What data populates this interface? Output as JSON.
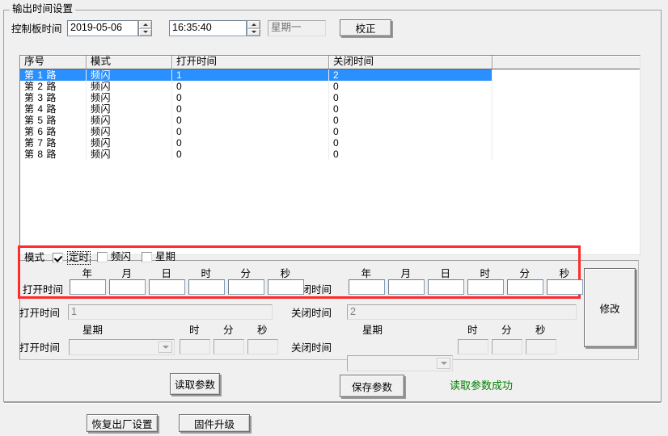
{
  "group": {
    "title": "输出时间设置"
  },
  "topbar": {
    "label": "控制板时间",
    "date_value": "2019-05-06",
    "time_value": "16:35:40",
    "weekday_value": "星期一",
    "correct_button": "校正"
  },
  "listview": {
    "columns": [
      "序号",
      "模式",
      "打开时间",
      "关闭时间",
      ""
    ],
    "rows": [
      {
        "no": "第 1 路",
        "mode": "频闪",
        "on": "1",
        "off": "2",
        "selected": true
      },
      {
        "no": "第 2 路",
        "mode": "频闪",
        "on": "0",
        "off": "0",
        "selected": false
      },
      {
        "no": "第 3 路",
        "mode": "频闪",
        "on": "0",
        "off": "0",
        "selected": false
      },
      {
        "no": "第 4 路",
        "mode": "频闪",
        "on": "0",
        "off": "0",
        "selected": false
      },
      {
        "no": "第 5 路",
        "mode": "频闪",
        "on": "0",
        "off": "0",
        "selected": false
      },
      {
        "no": "第 6 路",
        "mode": "频闪",
        "on": "0",
        "off": "0",
        "selected": false
      },
      {
        "no": "第 7 路",
        "mode": "频闪",
        "on": "0",
        "off": "0",
        "selected": false
      },
      {
        "no": "第 8 路",
        "mode": "频闪",
        "on": "0",
        "off": "0",
        "selected": false
      }
    ]
  },
  "mode": {
    "label": "模式",
    "options": [
      {
        "label": "定时",
        "checked": true,
        "focused": true
      },
      {
        "label": "频闪",
        "checked": false,
        "focused": false
      },
      {
        "label": "星期",
        "checked": false,
        "focused": false
      }
    ]
  },
  "timer_row": {
    "open_label": "打开时间",
    "close_label": "关闭时间",
    "units": [
      "年",
      "月",
      "日",
      "时",
      "分",
      "秒"
    ],
    "open_values": [
      "",
      "",
      "",
      "",
      "",
      ""
    ],
    "close_values": [
      "",
      "",
      "",
      "",
      "",
      ""
    ]
  },
  "strobe_row": {
    "open_label": "打开时间",
    "close_label": "关闭时间",
    "open_value": "1",
    "close_value": "2"
  },
  "week_row": {
    "open_label": "打开时间",
    "close_label": "关闭时间",
    "week_label": "星期",
    "units": [
      "时",
      "分",
      "秒"
    ],
    "open_week": "",
    "close_week": "",
    "open_values": [
      "",
      "",
      ""
    ],
    "close_values": [
      "",
      "",
      ""
    ]
  },
  "modify_button": {
    "label": "修改"
  },
  "actions": {
    "read_params": "读取参数",
    "save_params": "保存参数",
    "status_text": "读取参数成功",
    "status_color": "#008000"
  },
  "bottom": {
    "factory_reset": "恢复出厂设置",
    "firmware_upgrade": "固件升级"
  }
}
